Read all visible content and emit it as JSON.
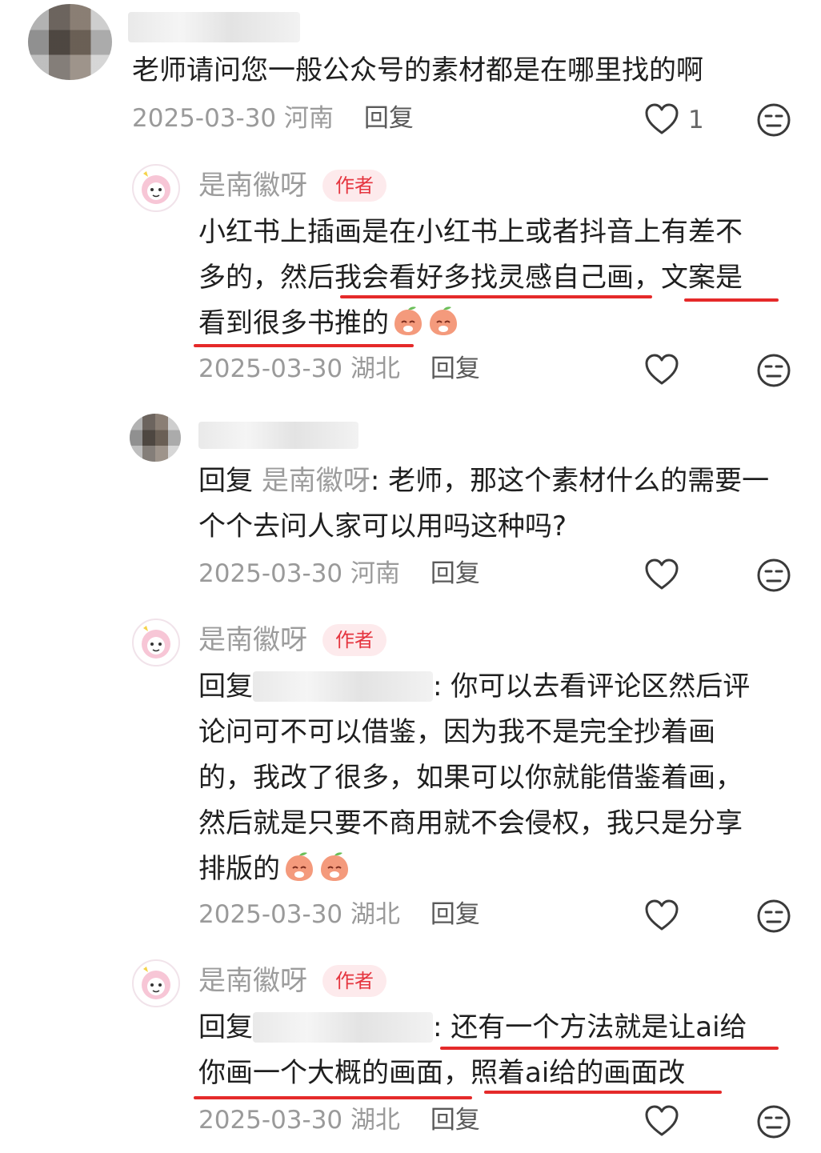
{
  "comments": [
    {
      "text": "老师请问您一般公众号的素材都是在哪里找的啊",
      "date": "2025-03-30",
      "location": "河南",
      "reply_label": "回复",
      "like_count": "1",
      "like_icon": "heart-outline-icon",
      "dislike_icon": "neutral-face-icon"
    },
    {
      "name": "是南徽呀",
      "badge": "作者",
      "lines": [
        "小红书上插画是在小红书上或者抖音上有差不",
        "多的，然后我会看好多找灵感自己画，文案是",
        "看到很多书推的"
      ],
      "date": "2025-03-30",
      "location": "湖北",
      "reply_label": "回复"
    },
    {
      "prefix": "回复",
      "mention": "是南徽呀",
      "line1_rest": ": 老师，那这个素材什么的需要一",
      "line2": "个个去问人家可以用吗这种吗?",
      "date": "2025-03-30",
      "location": "河南",
      "reply_label": "回复"
    },
    {
      "name": "是南徽呀",
      "badge": "作者",
      "prefix": "回复",
      "line1_rest": ": 你可以去看评论区然后评",
      "lines": [
        "论问可不可以借鉴，因为我不是完全抄着画",
        "的，我改了很多，如果可以你就能借鉴着画，",
        "然后就是只要不商用就不会侵权，我只是分享",
        "排版的"
      ],
      "date": "2025-03-30",
      "location": "湖北",
      "reply_label": "回复"
    },
    {
      "name": "是南徽呀",
      "badge": "作者",
      "prefix": "回复",
      "line1_rest": ": 还有一个方法就是让ai给",
      "line2": "你画一个大概的画面，照着ai给的画面改",
      "date": "2025-03-30",
      "location": "湖北",
      "reply_label": "回复"
    }
  ],
  "colors": {
    "badge_text": "#e5353f",
    "badge_bg": "#fdeaec",
    "underline": "#e52a2a",
    "meta": "#9a9a9a"
  }
}
